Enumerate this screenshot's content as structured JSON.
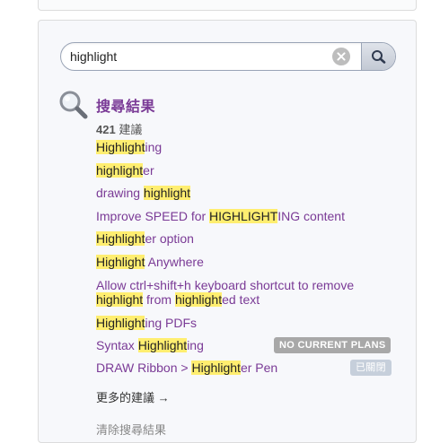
{
  "search": {
    "value": "highlight",
    "placeholder": ""
  },
  "results": {
    "title": "搜尋結果",
    "count": "421",
    "count_label": " 建議"
  },
  "suggestions": [
    {
      "parts": [
        {
          "h": "Highlight"
        },
        {
          "t": "ing"
        }
      ]
    },
    {
      "parts": [
        {
          "h": "highlight"
        },
        {
          "t": "er"
        }
      ]
    },
    {
      "parts": [
        {
          "t": "drawing "
        },
        {
          "h": "highlight"
        }
      ]
    },
    {
      "parts": [
        {
          "t": "Improve SPEED for "
        },
        {
          "h": "HIGHLIGHT"
        },
        {
          "t": "ING content"
        }
      ]
    },
    {
      "parts": [
        {
          "h": "Highlight"
        },
        {
          "t": "er option"
        }
      ]
    },
    {
      "parts": [
        {
          "h": "Highlight"
        },
        {
          "t": " Anywhere"
        }
      ]
    },
    {
      "parts": [
        {
          "t": "Allow ctrl+shift+h keyboard shortcut to remove "
        },
        {
          "h": "highlight"
        },
        {
          "t": " from "
        },
        {
          "h": "highlight"
        },
        {
          "t": "ed text"
        }
      ]
    },
    {
      "parts": [
        {
          "h": "Highlight"
        },
        {
          "t": "ing PDFs"
        }
      ]
    },
    {
      "parts": [
        {
          "t": "Syntax "
        },
        {
          "h": "Highlight"
        },
        {
          "t": "ing"
        }
      ],
      "badge": "NO CURRENT PLANS",
      "badge_type": "plans"
    },
    {
      "parts": [
        {
          "t": "DRAW Ribbon > "
        },
        {
          "h": "Highlight"
        },
        {
          "t": "er Pen"
        }
      ],
      "badge": "已關閉",
      "badge_type": "closed"
    }
  ],
  "more_link": "更多的建議 →",
  "footer_partial": "清除搜尋結果",
  "colors": {
    "accent": "#7a3a96",
    "highlight": "#ffee70"
  }
}
